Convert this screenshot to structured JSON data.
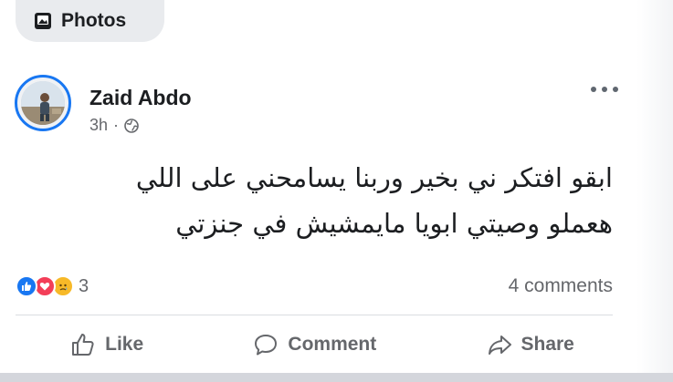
{
  "tab": {
    "label": "Photos",
    "icon": "photos-icon"
  },
  "post": {
    "author": "Zaid Abdo",
    "time": "3h",
    "separator": "·",
    "privacy_icon": "globe-icon",
    "text_line_1": "ابقو افتكر ني بخير وربنا يسامحني على اللي",
    "text_line_2": "هعملو وصيتي ابويا مايمشيش في جنزتي",
    "reactions": [
      "like",
      "love",
      "sad"
    ],
    "reaction_count": "3",
    "comments_count": "4 comments"
  },
  "actions": {
    "like": "Like",
    "comment": "Comment",
    "share": "Share"
  },
  "colors": {
    "accent": "#1877f2",
    "love": "#f33e58",
    "sad": "#f7b928",
    "muted_text": "#65676b"
  }
}
